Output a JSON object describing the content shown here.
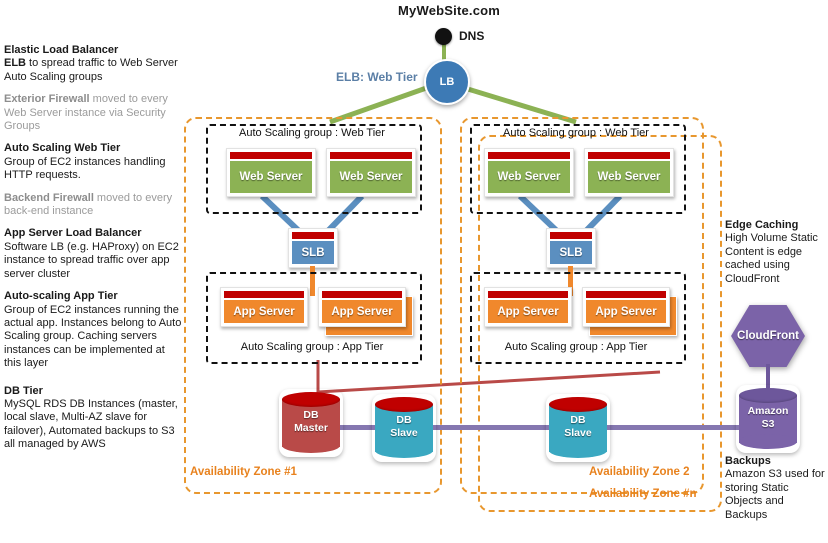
{
  "title": "MyWebSite.com",
  "dns": {
    "label": "DNS",
    "icon": "dns-dot-icon"
  },
  "elb": {
    "label": "ELB: Web Tier",
    "node_label": "LB"
  },
  "left_notes": [
    {
      "heading": "Elastic Load Balancer",
      "body_lead": "ELB",
      "body": " to  spread traffic to Web Server Auto Scaling groups",
      "dim": false
    },
    {
      "heading": "Exterior Firewall",
      "body_lead": "",
      "body": " moved to every Web Server instance via Security Groups",
      "dim": true
    },
    {
      "heading": "Auto Scaling Web Tier",
      "body_lead": "",
      "body": "Group of EC2 instances  handling HTTP requests.",
      "dim": false
    },
    {
      "heading": "Backend Firewall",
      "body_lead": "",
      "body": " moved to every back-end instance",
      "dim": true
    },
    {
      "heading": "App Server Load Balancer",
      "body_lead": "",
      "body": "Software LB (e.g. HAProxy) on EC2 instance to spread traffic over app server cluster",
      "dim": false
    },
    {
      "heading": "Auto-scaling App Tier",
      "body_lead": "",
      "body": "Group of EC2 instances  running the actual app.  Instances belong to Auto Scaling group. Caching  servers  instances can be implemented at this layer",
      "dim": false
    },
    {
      "heading": "DB Tier",
      "body_lead": "",
      "body": "MySQL RDS DB Instances (master, local slave, Multi-AZ slave for failover), Automated backups to S3 all managed by AWS",
      "dim": false
    }
  ],
  "right_notes": {
    "edge": {
      "heading": "Edge Caching",
      "body": "High Volume Static Content is edge cached using CloudFront"
    },
    "backups": {
      "heading": "Backups",
      "body": "Amazon S3 used for storing  Static Objects and Backups"
    }
  },
  "zones": [
    {
      "label": "Availability Zone #1"
    },
    {
      "label": "Availability Zone 2"
    },
    {
      "label": "Availability Zone #n"
    }
  ],
  "asg": {
    "web_label": "Auto Scaling group : Web Tier",
    "app_label": "Auto Scaling group : App Tier"
  },
  "nodes": {
    "web_server": "Web Server",
    "app_server": "App Server",
    "slb": "SLB",
    "db_master": "DB\nMaster",
    "db_master_line1": "DB",
    "db_master_line2": "Master",
    "db_slave_line1": "DB",
    "db_slave_line2": "Slave",
    "cloudfront": "CloudFront",
    "s3_line1": "Amazon",
    "s3_line2": "S3"
  },
  "colors": {
    "web": "#8cb254",
    "app": "#f0882c",
    "slb": "#5b8fc0",
    "cap_red": "#c00000",
    "db_master": "#b94a48",
    "db_slave": "#3aa8c1",
    "aws_purple": "#7b63a8",
    "zone_orange": "#e8972e",
    "elb_green": "#8cb254",
    "elb_blue": "#3d7ab5"
  }
}
